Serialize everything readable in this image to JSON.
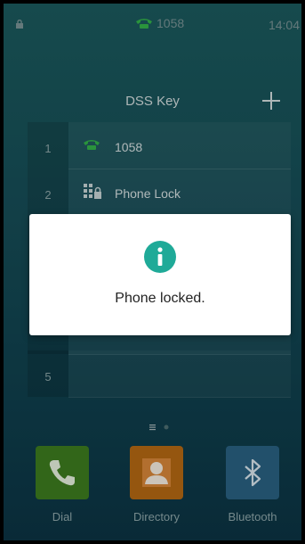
{
  "status_bar": {
    "account": "1058",
    "time": "14:04"
  },
  "dss": {
    "title": "DSS Key",
    "rows": [
      {
        "index": "1",
        "label": "1058"
      },
      {
        "index": "2",
        "label": "Phone Lock"
      },
      {
        "index": "5",
        "label": ""
      }
    ]
  },
  "dialog": {
    "message": "Phone locked."
  },
  "dock": {
    "dial": "Dial",
    "directory": "Directory",
    "bluetooth": "Bluetooth"
  },
  "colors": {
    "accent": "#1faa98",
    "line_green": "#34b44a",
    "dial_green": "#3d7d1f",
    "directory_orange": "#b66913",
    "bluetooth_blue": "#2a6283"
  },
  "icons": [
    "lock-icon",
    "phone-icon",
    "plus-icon",
    "phone-lock-icon",
    "info-icon",
    "bluetooth-icon",
    "contact-icon"
  ]
}
